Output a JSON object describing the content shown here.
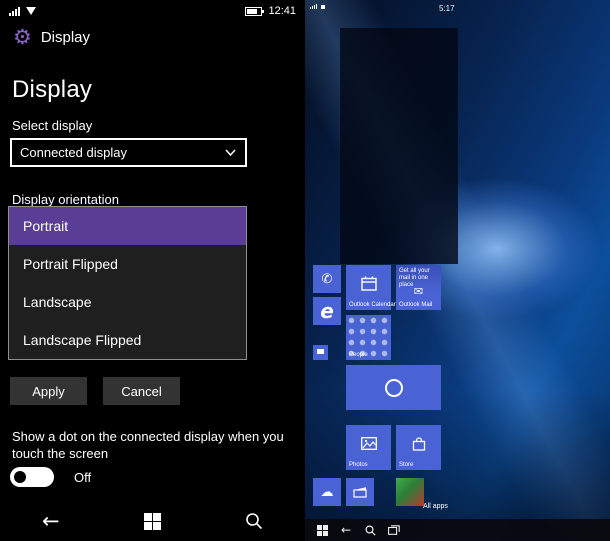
{
  "colors": {
    "accent_purple": "#5a3d94",
    "tile_blue": "#4a63d4",
    "background": "#000000"
  },
  "icons": {
    "gear": "⚙",
    "back_arrow": "←",
    "phone": "✆",
    "mail_envelope": "✉",
    "cloud": "☁",
    "edge_letter": "e"
  },
  "left": {
    "statusbar": {
      "time": "12:41"
    },
    "header": {
      "title": "Display"
    },
    "page_title": "Display",
    "select_display_label": "Select display",
    "display_select": {
      "value": "Connected display"
    },
    "orientation_label": "Display orientation",
    "orientation_options": [
      "Portrait",
      "Portrait Flipped",
      "Landscape",
      "Landscape Flipped"
    ],
    "selected_orientation": "Portrait",
    "apply_label": "Apply",
    "cancel_label": "Cancel",
    "touch_dot_text": "Show a dot on the connected display when you touch the screen",
    "toggle_label": "Off"
  },
  "right": {
    "status_time": "5:17",
    "tiles": {
      "outlook_calendar_label": "Outlook Calendar",
      "outlook_mail_label": "Outlook Mail",
      "outlook_mail_promo": "Get all your mail in one place",
      "people_label": "People",
      "photos_label": "Photos",
      "store_label": "Store"
    },
    "all_apps_label": "All apps"
  }
}
